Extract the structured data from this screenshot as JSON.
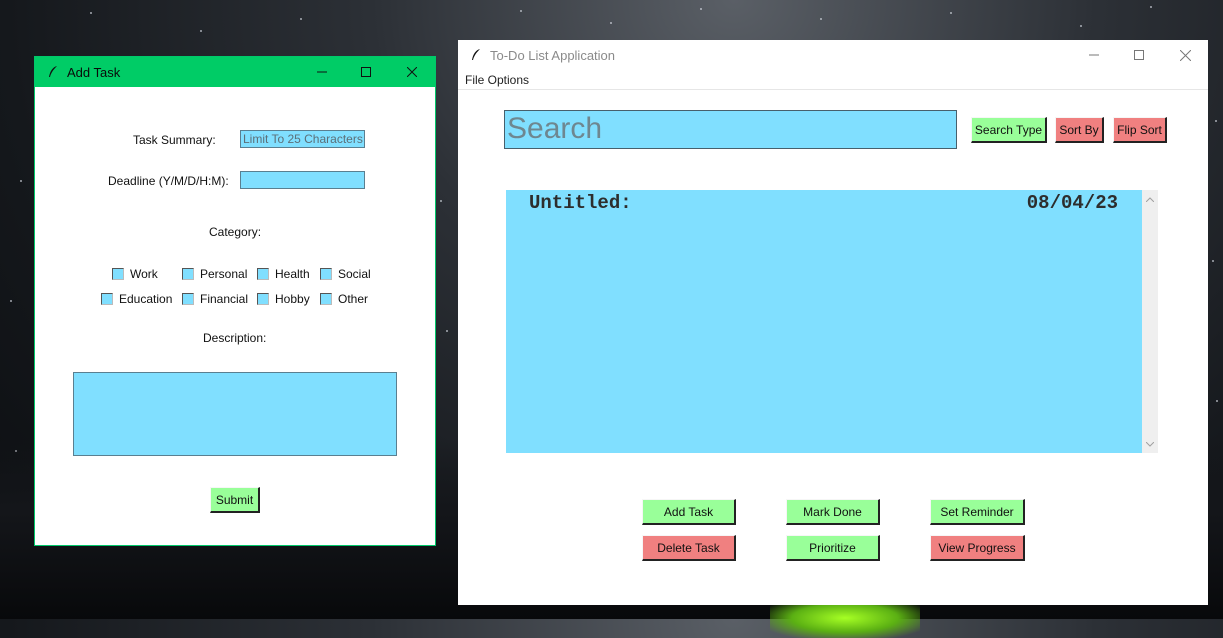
{
  "add_task_window": {
    "title": "Add Task",
    "task_summary_label": "Task Summary:",
    "task_summary_placeholder": "Limit To 25 Characters",
    "deadline_label": "Deadline (Y/M/D/H:M):",
    "deadline_value": "",
    "category_label": "Category:",
    "categories": [
      "Work",
      "Personal",
      "Health",
      "Social",
      "Education",
      "Financial",
      "Hobby",
      "Other"
    ],
    "description_label": "Description:",
    "description_value": "",
    "submit_label": "Submit"
  },
  "main_window": {
    "title": "To-Do List Application",
    "menu": [
      "File Options"
    ],
    "search_placeholder": "Search",
    "search_type_label": "Search Type",
    "sort_by_label": "Sort By",
    "flip_sort_label": "Flip Sort",
    "tasks": [
      {
        "name": "Untitled:",
        "date": "08/04/23"
      }
    ],
    "buttons": {
      "add_task": "Add Task",
      "mark_done": "Mark Done",
      "set_reminder": "Set Reminder",
      "delete_task": "Delete Task",
      "prioritize": "Prioritize",
      "view_progress": "View Progress"
    }
  },
  "colors": {
    "field_bg": "#80dfff",
    "green_button": "#99ff99",
    "red_button": "#f08080",
    "add_task_titlebar": "#00cc66"
  },
  "icons": [
    "feather-icon",
    "minimize-icon",
    "maximize-icon",
    "close-icon",
    "scroll-up-icon",
    "scroll-down-icon"
  ]
}
